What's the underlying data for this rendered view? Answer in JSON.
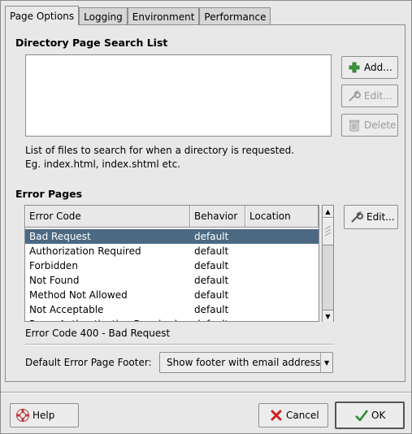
{
  "tabs": [
    "Page Options",
    "Logging",
    "Environment",
    "Performance"
  ],
  "directory": {
    "heading": "Directory Page Search List",
    "add_label": "Add...",
    "edit_label": "Edit...",
    "delete_label": "Delete",
    "hint_line1": "List of files to search for when a directory is requested.",
    "hint_line2": "Eg. index.html, index.shtml etc."
  },
  "errors": {
    "heading": "Error Pages",
    "columns": [
      "Error Code",
      "Behavior",
      "Location"
    ],
    "rows": [
      {
        "code": "Bad Request",
        "behavior": "default",
        "location": ""
      },
      {
        "code": "Authorization Required",
        "behavior": "default",
        "location": ""
      },
      {
        "code": "Forbidden",
        "behavior": "default",
        "location": ""
      },
      {
        "code": "Not Found",
        "behavior": "default",
        "location": ""
      },
      {
        "code": "Method Not Allowed",
        "behavior": "default",
        "location": ""
      },
      {
        "code": "Not Acceptable",
        "behavior": "default",
        "location": ""
      },
      {
        "code": "Proxy Authentication Required",
        "behavior": "default",
        "location": ""
      }
    ],
    "edit_label": "Edit...",
    "status": "Error Code 400 - Bad Request",
    "footer_label": "Default Error Page Footer:",
    "footer_value": "Show footer with email address"
  },
  "buttons": {
    "help": "Help",
    "cancel": "Cancel",
    "ok": "OK"
  },
  "colors": {
    "selection": "#4b6983"
  }
}
